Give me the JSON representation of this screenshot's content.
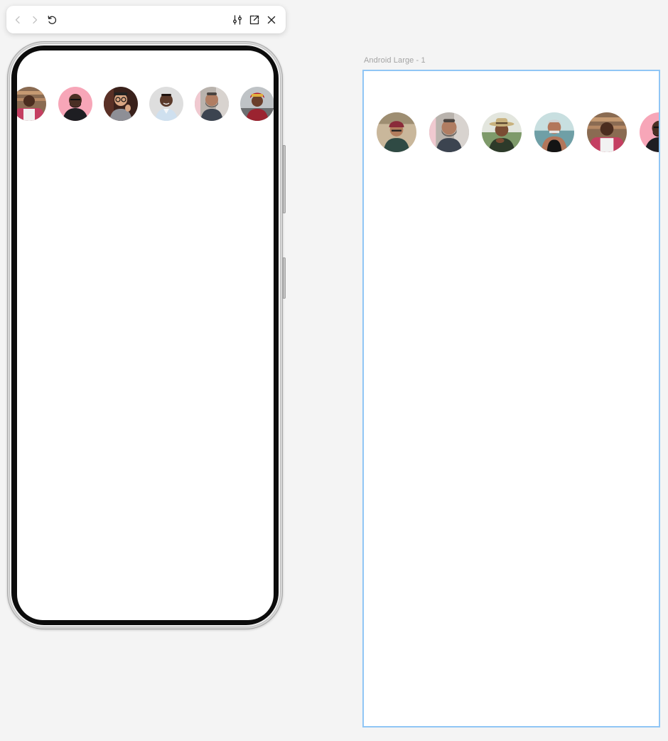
{
  "toolbar": {
    "icons": [
      "chevron-left-icon",
      "chevron-right-icon",
      "restart-icon",
      "sliders-icon",
      "open-external-icon",
      "close-icon"
    ]
  },
  "frame": {
    "label": "Android Large - 1"
  },
  "colors": {
    "canvas_background": "#f4f4f4",
    "frame_selection": "#90c6f5",
    "frame_label": "#a3a3a3",
    "avatar_pink_background": "#f7a6b8"
  },
  "prototype_avatars": [
    {
      "subject": "person-in-apron"
    },
    {
      "subject": "person-on-pink"
    },
    {
      "subject": "person-with-glasses"
    },
    {
      "subject": "person-smiling"
    },
    {
      "subject": "person-with-beard"
    },
    {
      "subject": "person-with-headscarf"
    }
  ],
  "canvas_avatars": [
    {
      "subject": "person-in-knit-cap"
    },
    {
      "subject": "person-with-beard"
    },
    {
      "subject": "person-in-hat"
    },
    {
      "subject": "person-in-tank-top"
    },
    {
      "subject": "person-in-apron"
    },
    {
      "subject": "person-on-pink"
    }
  ]
}
